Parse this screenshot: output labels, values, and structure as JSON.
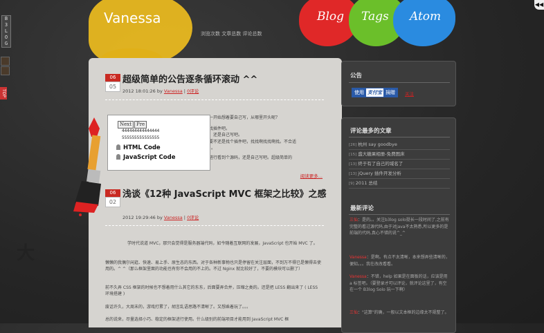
{
  "site": {
    "title": "Vanessa"
  },
  "header": {
    "stats": [
      {
        "label": "浏览次数",
        "value": ""
      },
      {
        "label": "文章总数",
        "value": ""
      },
      {
        "label": "评论总数",
        "value": ""
      }
    ],
    "nav": [
      "Blog",
      "Tags",
      "Atom"
    ]
  },
  "left_tab": {
    "letters": [
      "B",
      "3",
      "L",
      "O",
      "G"
    ]
  },
  "top_button": "TOP",
  "corner_button": "◀◀",
  "posts": [
    {
      "month": "06",
      "day": "05",
      "title": "超级简单的公告逐条循环滚动 ^^",
      "meta_time": "2012 18:01:26 by",
      "author": "Vanessa",
      "comments": "0评论",
      "excerpt": [
        "一开始想着要自己写，从哪里开头呢？",
        "找插件吧。",
        "，还是自己写吧。",
        "要不还是找个插件吧，找找啊找找啊找。不合适",
        "。。",
        "",
        "进行看到个源码，还是自己写吧。超级简单的"
      ],
      "read_more": "阅读更多..."
    },
    {
      "month": "06",
      "day": "02",
      "title": "浅谈《12种 JavaScript MVC 框架之比较》之感",
      "meta_time": "2012 19:29:46 by",
      "author": "Vanessa",
      "comments": "0评论"
    }
  ],
  "popup": {
    "buttons": [
      "Next",
      "Pre"
    ],
    "numbers": [
      "444444444444444",
      "555555555555555"
    ],
    "items": [
      "HTML Code",
      "JavaScript Code"
    ]
  },
  "article": {
    "big_char": "大",
    "paragraphs": [
      "学时代说道 MVC，那只会觉得是服务器端代码，如今随着互联网的发展，JavaScript 也开始 MVC 了。",
      "懒懒的我偶尔闲逛、快速、易上手、原生态的东西。对于各种新事物也只是停留在关注层面，不到万不得已是懒得去使用的。^ ^（那么框架里面的功能也有你不会用的不上的。不过 Nginx 就比较好了，不要的模块可以删了）",
      "前不久弄 CSS 框架的时候也不想着用什么其它的东东，后面要弄合并，压缩之类的。还是把 LESS 翻出来了 ( LESS 环境搭建 )",
      "废话许久，大周末的，游戏打累了，胡言乱语思路不清晰了。又想乘着玩了。。。",
      "总的说来，尽量选择小巧、稳定的框架进行使用。什么级别的前端项目才能用到 JavaScript MVC 框"
    ],
    "links": [
      "Nginx",
      "LESS 环境搭建"
    ]
  },
  "sidebar": {
    "notice_title": "公告",
    "alipay": {
      "left": "使用",
      "brand": "支付宝",
      "right": "捐赠"
    },
    "alipay_link": "关注",
    "top_title": "评论最多的文章",
    "top_articles": [
      {
        "count": "[26]",
        "title": "杭州 say goodbye"
      },
      {
        "count": "[15]",
        "title": "盛大糖果相册-免费图床"
      },
      {
        "count": "[13]",
        "title": "终于有了自己的域名了"
      },
      {
        "count": "[13]",
        "title": "jQuery 插件开发分析"
      },
      {
        "count": "[9]",
        "title": "2011 总结"
      }
    ],
    "comments_title": "最新评论",
    "comments": [
      {
        "user": "三仙",
        "text": "：是的。。关注b3log solo挺长一段时间了,之前有完整的看过源代码,由于对java不太熟悉,所以更多的是前端的代码,真心不错的说^_^"
      },
      {
        "user": "Vanessa",
        "text": "：是啊。有点不太清晰，本来想弄些清晰的，便知。。。我在改改看看。"
      },
      {
        "user": "Vanessa",
        "text": "：不错，help 如果是在面板的话，应该是用 a 标签吧。（要登录才可以评论，就评论这里了，有空在一个 B3log Solo 玩一下啊）"
      },
      {
        "user": "三仙",
        "text": "：\"这算\"的确，一般以文本框的边缘太不规整了。"
      }
    ]
  },
  "colors": {
    "accent": "#c92a22",
    "yellow": "#e8b820",
    "red": "#e02828",
    "green": "#6bbf2a",
    "blue": "#2a8be0"
  }
}
